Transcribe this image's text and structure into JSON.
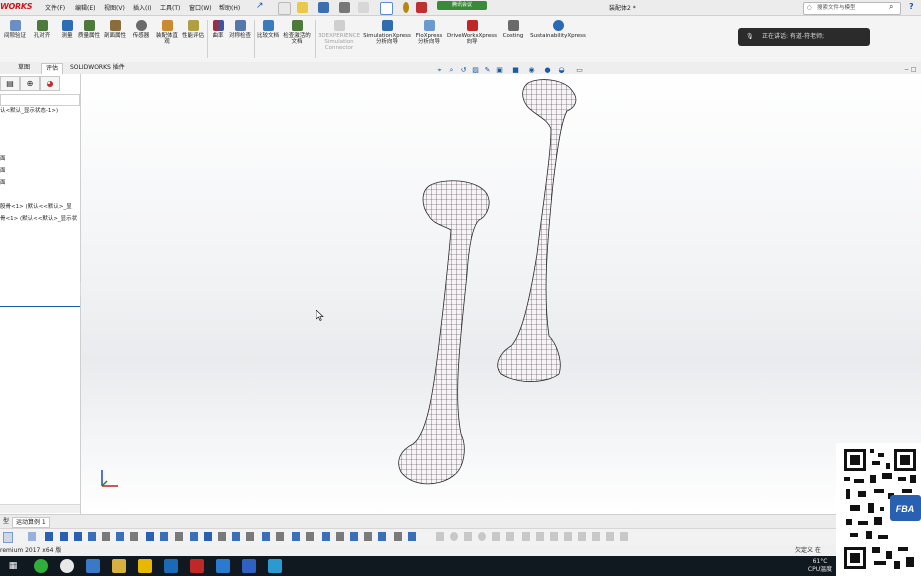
{
  "app": {
    "logo": "WORKS",
    "menus": [
      "文件(F)",
      "编辑(E)",
      "视图(V)",
      "插入(I)",
      "工具(T)",
      "窗口(W)",
      "帮助(H)"
    ],
    "meeting_badge": "腾讯会议",
    "document_title": "装配体2 *",
    "search_placeholder": "搜索文件与模型",
    "help_icon": "?"
  },
  "ribbon": {
    "buttons": [
      {
        "label": "间隙验证",
        "icon": "clearance-icon"
      },
      {
        "label": "孔对齐",
        "icon": "hole-align-icon"
      },
      {
        "label": "测量",
        "icon": "measure-icon"
      },
      {
        "label": "质量属性",
        "icon": "mass-props-icon"
      },
      {
        "label": "剖面属性",
        "icon": "section-props-icon"
      },
      {
        "label": "传感器",
        "icon": "sensor-icon"
      },
      {
        "label": "装配体直观",
        "icon": "assembly-visual-icon"
      },
      {
        "label": "性能评估",
        "icon": "performance-icon"
      },
      {
        "label": "曲率",
        "icon": "curvature-icon"
      },
      {
        "label": "对称检查",
        "icon": "symmetry-icon"
      },
      {
        "label": "比较文档",
        "icon": "compare-icon"
      },
      {
        "label": "检查激活的文档",
        "icon": "check-active-icon"
      },
      {
        "label": "3DEXPERIENCE Simulation Connector",
        "icon": "3dx-icon",
        "disabled": true
      },
      {
        "label": "SimulationXpress 分析向导",
        "icon": "simulationxpress-icon"
      },
      {
        "label": "FloXpress 分析向导",
        "icon": "floxpress-icon"
      },
      {
        "label": "DriveWorksXpress 向导",
        "icon": "driveworks-icon"
      },
      {
        "label": "Costing",
        "icon": "costing-icon"
      },
      {
        "label": "SustainabilityXpress",
        "icon": "sustainability-icon"
      }
    ],
    "voice_status": "正在讲话: 有道-符老师;"
  },
  "tabs": [
    "草图",
    "评估",
    "SOLIDWORKS 插件"
  ],
  "feature_tree": {
    "lines": [
      "认<默认_显示状态-1>)",
      "面",
      "面",
      "面",
      "股骨<1> (默认<<默认>_显",
      "骨<1> (默认<<默认>_显示状"
    ]
  },
  "bottom_tabs": [
    "型",
    "运动算例 1"
  ],
  "status": {
    "left": "remium 2017 x64 版",
    "right": "欠定义   在"
  },
  "tray": {
    "temp": "61°C",
    "cpu": "CPU温度"
  },
  "qr_caption": "FBA"
}
